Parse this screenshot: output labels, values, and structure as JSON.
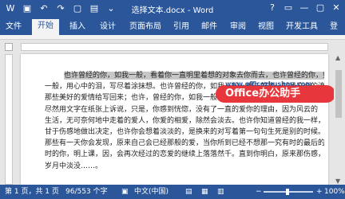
{
  "titlebar": {
    "title": "选择文本.docx - Word",
    "qat": {
      "save_icon": "save-icon",
      "undo_icon": "undo-icon",
      "redo_icon": "redo-icon",
      "new_icon": "new-doc-icon",
      "open_icon": "open-icon",
      "more_icon": "chevron-down-icon"
    },
    "window_buttons": [
      "?",
      "▭",
      "—",
      "▢",
      "✕"
    ]
  },
  "tabs": [
    {
      "label": "文件"
    },
    {
      "label": "开始"
    },
    {
      "label": "插入"
    },
    {
      "label": "设计"
    },
    {
      "label": "页面布局"
    },
    {
      "label": "引用"
    },
    {
      "label": "邮件"
    },
    {
      "label": "审阅"
    },
    {
      "label": "视图"
    },
    {
      "label": "开发工具"
    },
    {
      "label": "登"
    }
  ],
  "document": {
    "lines": [
      "也许曾经的你，如我一般，看着你一直明里着想的对象去你而去，也许曾经的你，如我",
      "一般，用心中的泪，写尽着涂抹想。也许曾经的你，如我一般，用心的笔，就是这个的流",
      "那些美好的爱情给写回来；也许，曾经的你，如我一般，以为时间可以换回彼此的温度",
      "尽然用文字在纸张上诉说，只是，你感到恍惚，没有了一直的爱你的理由，因为风云的",
      "生活，无可奈何地中走着的爱人，你爱的相爱，除然会淡去。也许你知道曾经的我一样，不",
      "甘于伤感地做出决定，也许你会想着淡淡的，是换来的对写着第一句句生死是别的时候。",
      "那些有一天你会发现，原来自己会已经那般的爱，当你所到已经不想那一究有时的最后的亲",
      "时的你，明上课，因，会再次经过的恋爱的继续上落落然千。直到你明白，原来那伤感，如",
      "岁月中淡没……。"
    ],
    "first_line_highlighted": true
  },
  "watermark": {
    "text": "Office办公助手",
    "url": "www.officezhushou.com"
  },
  "statusbar": {
    "page": "第 1 页，共 1 页",
    "words": "96/553 个字",
    "language": "中文(中国)",
    "zoom_minus": "−",
    "zoom_plus": "+",
    "zoom": "100%"
  },
  "colors": {
    "accent": "#2b579a",
    "badge": "#e8373c",
    "highlight": "#c7c7c7"
  }
}
